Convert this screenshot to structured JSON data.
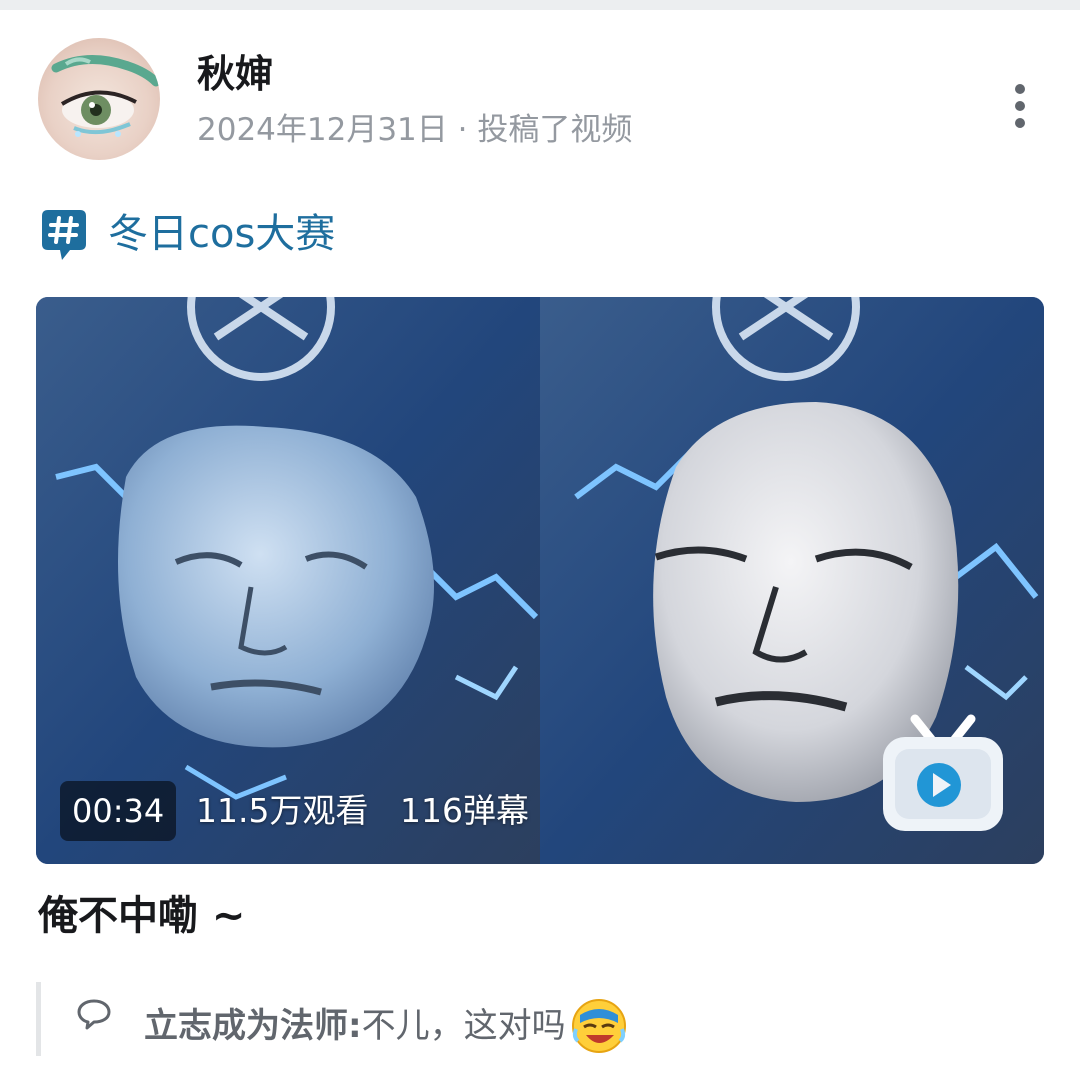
{
  "author": {
    "name": "秋婶",
    "meta": "2024年12月31日 · 投稿了视频",
    "avatar_icon": "avatar-image"
  },
  "topic": {
    "icon": "hashtag-icon",
    "label": "冬日cos大赛",
    "color": "#1e6e9e"
  },
  "video": {
    "duration": "00:34",
    "views": "11.5万观看",
    "danmaku": "116弹幕",
    "logo_icon": "bilibili-tv-icon"
  },
  "caption": "俺不中嘞 ~",
  "comment": {
    "user": "立志成为法师:",
    "text": " 不儿，这对吗",
    "emoji": "laughing-crying-emoji"
  },
  "colors": {
    "text_primary": "#18191c",
    "text_secondary": "#9499a0",
    "accent_blue": "#1e6e9e"
  }
}
